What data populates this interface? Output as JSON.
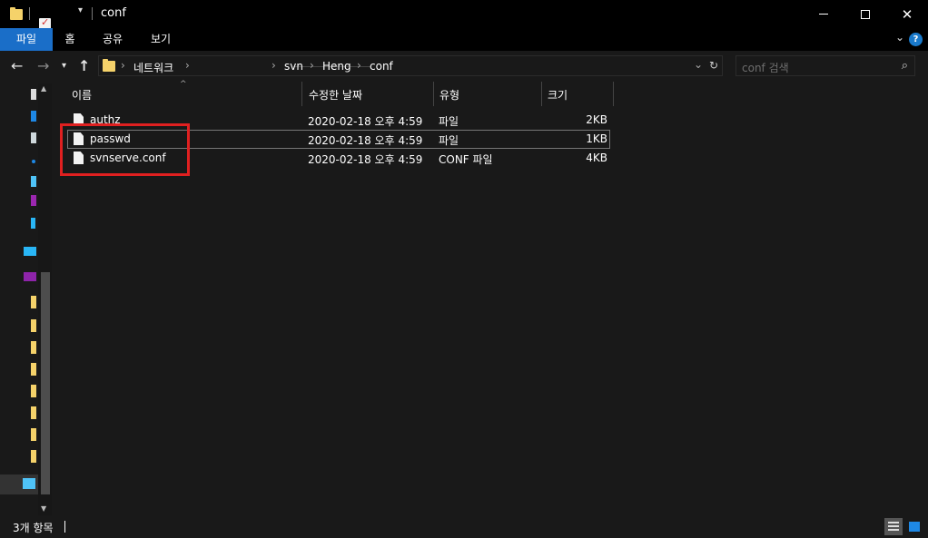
{
  "window": {
    "title": "conf"
  },
  "ribbon": {
    "tabs": [
      "파일",
      "홈",
      "공유",
      "보기"
    ],
    "help": "?"
  },
  "address": {
    "crumbs": [
      "네트워크",
      "svn",
      "Heng",
      "conf"
    ]
  },
  "search": {
    "placeholder": "conf 검색"
  },
  "columns": {
    "name": "이름",
    "date": "수정한 날짜",
    "type": "유형",
    "size": "크기"
  },
  "files": [
    {
      "name": "authz",
      "date": "2020-02-18 오후 4:59",
      "type": "파일",
      "size": "2KB"
    },
    {
      "name": "passwd",
      "date": "2020-02-18 오후 4:59",
      "type": "파일",
      "size": "1KB"
    },
    {
      "name": "svnserve.conf",
      "date": "2020-02-18 오후 4:59",
      "type": "CONF 파일",
      "size": "4KB"
    }
  ],
  "status": {
    "item_count": "3개 항목"
  },
  "colors": {
    "accent": "#1a6ec8",
    "highlight": "#e02020",
    "folder": "#f5d26a"
  }
}
